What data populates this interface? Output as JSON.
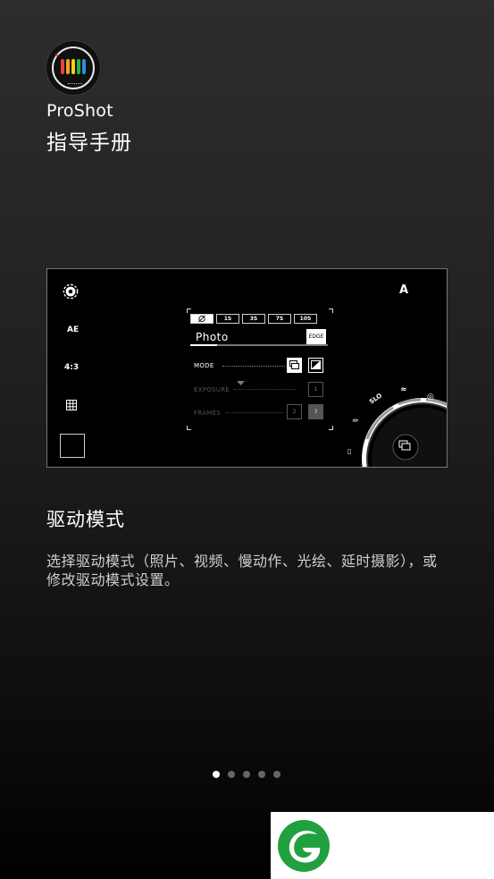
{
  "app": {
    "name": "ProShot",
    "guide_title": "指导手册"
  },
  "camera_preview": {
    "left_controls": {
      "ae": "AE",
      "aspect": "4:3"
    },
    "flash_mode": "A",
    "shutter_options": [
      "1S",
      "3S",
      "7S",
      "10S"
    ],
    "drive_mode_name": "Photo",
    "edge_label": "EDGE",
    "rows": {
      "mode": "MODE",
      "exposure": "EXPOSURE",
      "frames": "FRAMES"
    },
    "exposure_value": "1",
    "frames_values": [
      "2",
      "3"
    ],
    "dial_labels": {
      "slo": "SLO"
    }
  },
  "section": {
    "title": "驱动模式",
    "description": "选择驱动模式（照片、视频、慢动作、光绘、延时摄影），或修改驱动模式设置。"
  },
  "pager": {
    "total": 5,
    "active": 0
  },
  "colors": {
    "accent_white": "#ffffff",
    "dot_inactive": "#666666",
    "logo_green": "#21a040"
  }
}
